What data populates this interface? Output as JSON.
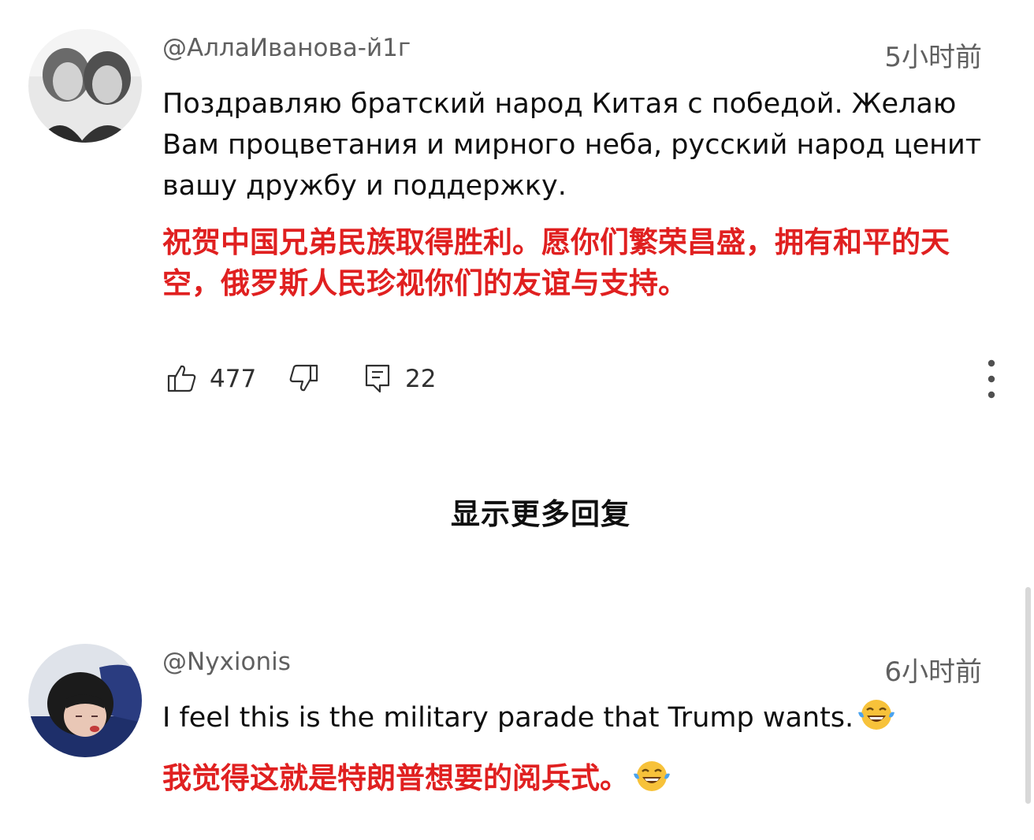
{
  "comments": [
    {
      "author": "@АллаИванова-й1г",
      "time": "5小时前",
      "text": "Поздравляю братский народ Китая с победой. Желаю Вам процветания и мирного неба, русский народ ценит вашу дружбу и поддержку.",
      "translation": "祝贺中国兄弟民族取得胜利。愿你们繁荣昌盛，拥有和平的天空，俄罗斯人民珍视你们的友谊与支持。",
      "likes": "477",
      "replies": "22"
    },
    {
      "author": "@Nyxionis",
      "time": "6小时前",
      "text": "I feel this is the military parade that Trump wants.",
      "translation": "我觉得这就是特朗普想要的阅兵式。"
    }
  ],
  "show_more_replies": "显示更多回复",
  "icons": {
    "like": "thumb-up-icon",
    "dislike": "thumb-down-icon",
    "reply": "reply-icon",
    "more": "more-vert-icon",
    "emoji": "tears-of-joy-emoji"
  },
  "colors": {
    "translation": "#e02020",
    "meta": "#606060"
  }
}
